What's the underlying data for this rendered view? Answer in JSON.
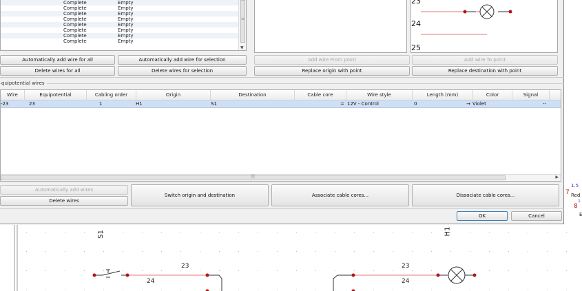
{
  "status_list": {
    "rows": [
      {
        "status": "Complete",
        "fill": "Empty"
      },
      {
        "status": "Complete",
        "fill": "Empty"
      },
      {
        "status": "Complete",
        "fill": "Empty"
      },
      {
        "status": "Complete",
        "fill": "Empty"
      },
      {
        "status": "Complete",
        "fill": "Empty"
      },
      {
        "status": "Complete",
        "fill": "Empty"
      },
      {
        "status": "Complete",
        "fill": "Empty"
      },
      {
        "status": "Complete",
        "fill": "Empty"
      }
    ]
  },
  "buttons": {
    "auto_add_all": "Automatically add wire for all",
    "auto_add_selection": "Automatically add wire for selection",
    "delete_all": "Delete wires for all",
    "delete_selection": "Delete wires for selection",
    "add_from_point": "Add wire From point",
    "add_to_point": "Add wire To point",
    "replace_origin": "Replace origin with point",
    "replace_destination": "Replace destination with point",
    "auto_add_wires": "Automatically add wires",
    "delete_wires": "Delete wires",
    "switch": "Switch origin and destination",
    "associate": "Associate cable cores...",
    "dissociate": "Dissociate cable cores...",
    "ok": "OK",
    "cancel": "Cancel"
  },
  "preview": {
    "numbers": [
      "23",
      "24",
      "25"
    ]
  },
  "wires_group": {
    "label": "quipotential wires",
    "columns": [
      "Wire",
      "Equipotential",
      "Cabling order",
      "Origin",
      "Destination",
      "Cable core",
      "Wire style",
      "Length (mm)",
      "Color",
      "Signal"
    ],
    "rows": [
      {
        "wire": "-23",
        "equipotential": "23",
        "cabling_order": "1",
        "origin": "H1",
        "destination": "S1",
        "cable_core": "",
        "wire_style": "12V - Control",
        "wire_style_mark": "=",
        "length": "0",
        "color": "Violet",
        "color_mark": "→",
        "signal": "--"
      }
    ]
  },
  "side_labels": {
    "value": "1.5",
    "wire7": "7",
    "color": "Red",
    "wire8": "8",
    "small": "1",
    "e": "E"
  },
  "schematic": {
    "left_component": "S1",
    "right_component": "H1",
    "left_top_wire": "23",
    "left_bottom_wire": "24",
    "right_top_wire": "23",
    "right_bottom_wire": "24"
  },
  "colors": {
    "wire_line": "#e4787a",
    "wire_dot": "#b0141a",
    "selection": "#cfe0f6",
    "blue_label": "#2a3fd0",
    "red_label": "#d01515"
  }
}
